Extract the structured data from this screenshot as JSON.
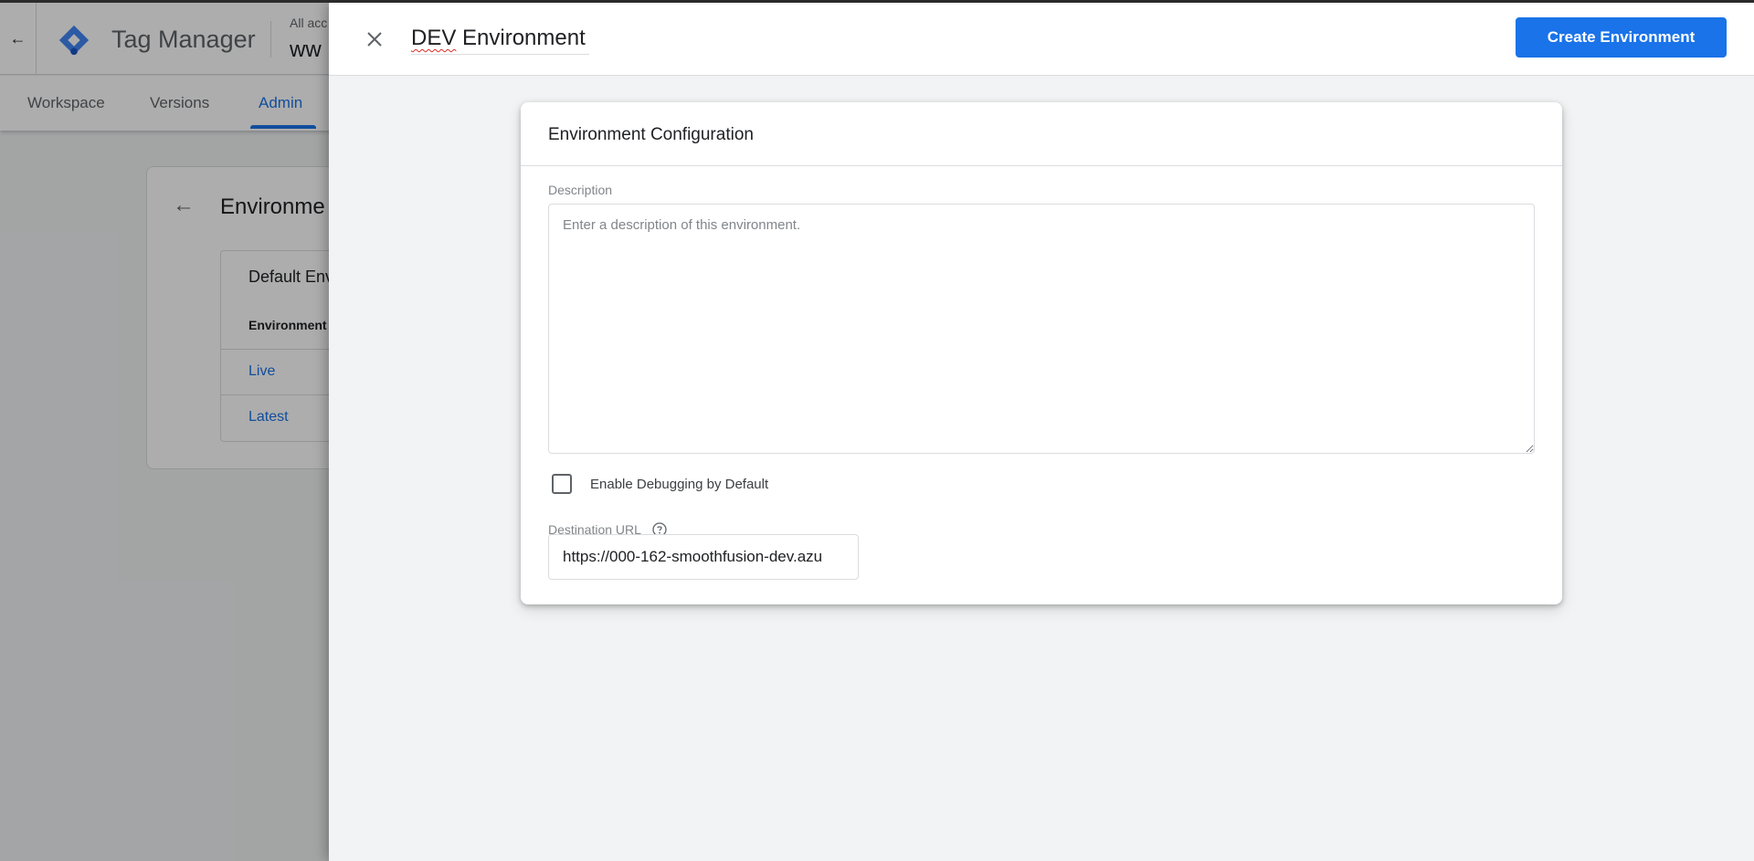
{
  "background": {
    "app_name": "Tag Manager",
    "account_breadcrumb": "All acc",
    "container_name": "ww",
    "tabs": [
      {
        "label": "Workspace",
        "active": false
      },
      {
        "label": "Versions",
        "active": false
      },
      {
        "label": "Admin",
        "active": true
      }
    ],
    "page_title": "Environme",
    "table": {
      "title": "Default Env",
      "column_header": "Environment",
      "rows": [
        "Live",
        "Latest"
      ]
    }
  },
  "panel": {
    "title": "DEV Environment",
    "title_misspelled_word": "DEV",
    "title_rest": " Environment",
    "create_button": "Create Environment",
    "card": {
      "heading": "Environment Configuration",
      "description_label": "Description",
      "description_placeholder": "Enter a description of this environment.",
      "description_value": "",
      "debug_checkbox_label": "Enable Debugging by Default",
      "debug_checked": false,
      "destination_url_label": "Destination URL",
      "destination_url_value": "https://000-162-smoothfusion-dev.azu"
    }
  },
  "icons": {
    "close": "close-icon",
    "help": "help-circle-icon",
    "back": "arrow-back-icon",
    "logo": "tag-manager-logo"
  },
  "colors": {
    "accent": "#1a73e8",
    "panel_bg": "#f1f3f4",
    "spellcheck": "#d93025"
  }
}
